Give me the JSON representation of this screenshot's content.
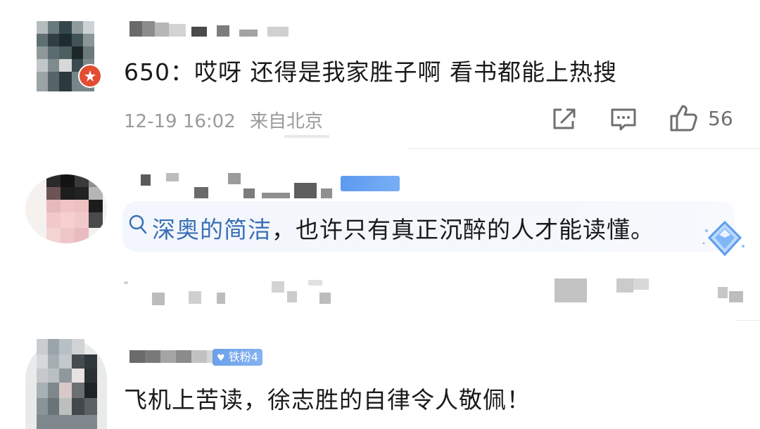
{
  "comments": [
    {
      "text": "650：哎呀 还得是我家胜子啊 看书都能上热搜",
      "time": "12-19 16:02",
      "location": "来自北京",
      "like_count": "56",
      "share_icon": "share-icon",
      "comment_icon": "comment-icon",
      "like_icon": "thumbs-up-icon"
    },
    {
      "search_term": "深奥的简洁",
      "text_rest": "，也许只有真正沉醉的人才能读懂。",
      "search_icon": "search-icon",
      "sticker_icon": "diamond-sticker-icon"
    },
    {
      "badge": "铁粉4",
      "text": "飞机上苦读，徐志胜的自律令人敬佩！"
    }
  ]
}
